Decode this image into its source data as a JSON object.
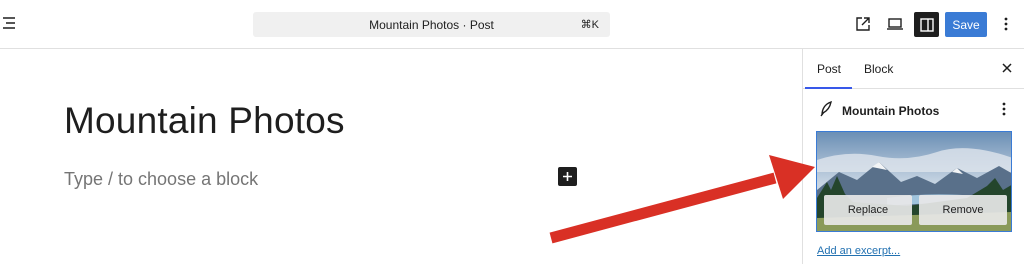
{
  "toolbar": {
    "command_bar": {
      "title": "Mountain Photos · Post",
      "shortcut": "⌘K"
    },
    "save_label": "Save"
  },
  "editor": {
    "title": "Mountain Photos",
    "block_placeholder": "Type / to choose a block"
  },
  "sidebar": {
    "tabs": [
      {
        "label": "Post",
        "active": true
      },
      {
        "label": "Block",
        "active": false
      }
    ],
    "post_title": "Mountain Photos",
    "featured_image": {
      "replace_label": "Replace",
      "remove_label": "Remove"
    },
    "excerpt_link": "Add an excerpt..."
  },
  "colors": {
    "accent": "#3a7bd5",
    "arrow": "#d93025"
  }
}
